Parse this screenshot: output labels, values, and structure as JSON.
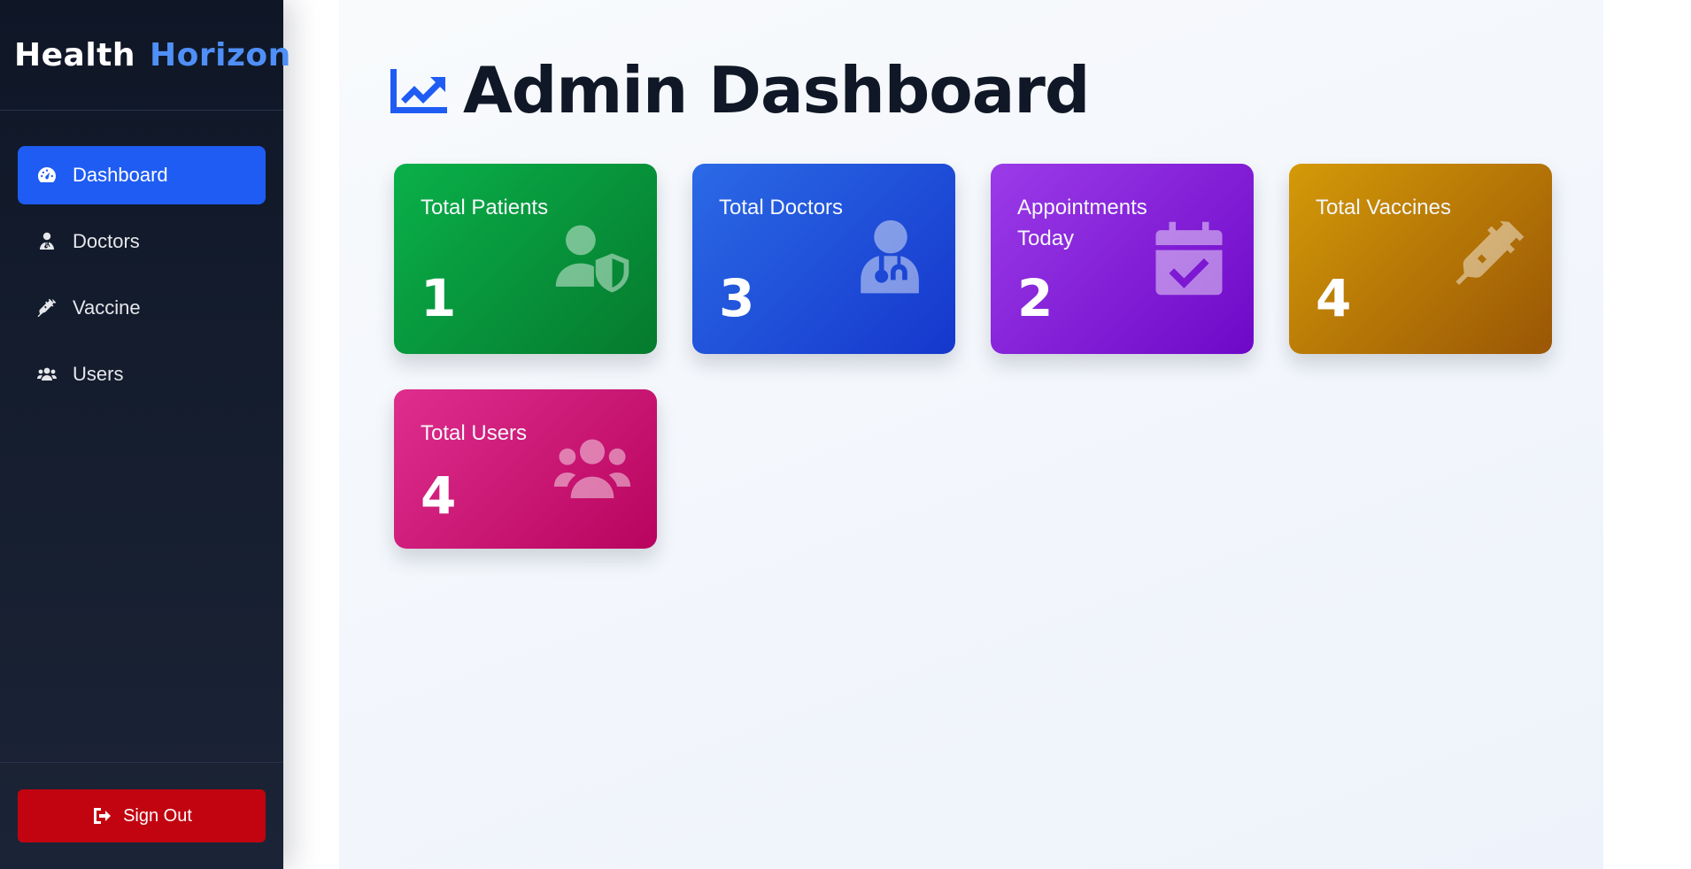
{
  "brand": {
    "part1": "Health",
    "part2": "Horizon"
  },
  "sidebar": {
    "items": [
      {
        "label": "Dashboard",
        "icon": "gauge-icon",
        "active": true
      },
      {
        "label": "Doctors",
        "icon": "user-doctor-icon",
        "active": false
      },
      {
        "label": "Vaccine",
        "icon": "syringe-icon",
        "active": false
      },
      {
        "label": "Users",
        "icon": "users-icon",
        "active": false
      }
    ],
    "signout_label": "Sign Out"
  },
  "main": {
    "title": "Admin Dashboard",
    "title_icon": "chart-line-icon",
    "cards": [
      {
        "label": "Total Patients",
        "value": "1",
        "icon": "user-shield-icon",
        "color_start": "#0ab04a",
        "color_end": "#057a2d"
      },
      {
        "label": "Total Doctors",
        "value": "3",
        "icon": "user-doctor-icon",
        "color_start": "#2b6ae6",
        "color_end": "#1537cc"
      },
      {
        "label": "Appointments Today",
        "value": "2",
        "icon": "calendar-check-icon",
        "color_start": "#9b3be8",
        "color_end": "#6e08c8"
      },
      {
        "label": "Total Vaccines",
        "value": "4",
        "icon": "syringe-icon",
        "color_start": "#d49a08",
        "color_end": "#9a5605"
      },
      {
        "label": "Total Users",
        "value": "4",
        "icon": "users-icon",
        "color_start": "#de2e8e",
        "color_end": "#b8045e"
      }
    ]
  },
  "colors": {
    "sidebar_bg": "#0f1727",
    "accent": "#1f5cf3",
    "brand_highlight": "#4f8ff7",
    "signout": "#c10410",
    "title_text": "#101827"
  }
}
